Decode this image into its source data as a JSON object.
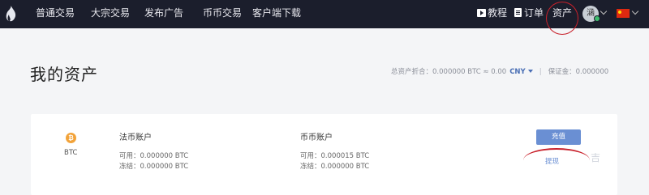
{
  "nav": {
    "items": [
      "普通交易",
      "大宗交易",
      "发布广告",
      "币币交易",
      "客户端下载"
    ],
    "tutorial": "教程",
    "orders": "订单",
    "assets": "资产",
    "avatar_initial": "涵"
  },
  "page": {
    "title": "我的资产",
    "total_label": "总资产折合：",
    "total_value": "0.000000 BTC ≈ 0.00",
    "currency": "CNY",
    "deposit_label": "保证金：",
    "deposit_value": "0.000000"
  },
  "asset": {
    "coin": "BTC",
    "coin_icon": "₿",
    "fiat_account": {
      "title": "法币账户",
      "available_label": "可用：",
      "available": "0.000000 BTC",
      "frozen_label": "冻结：",
      "frozen": "0.000000 BTC"
    },
    "coin_account": {
      "title": "币币账户",
      "available_label": "可用：",
      "available": "0.000015 BTC",
      "frozen_label": "冻结：",
      "frozen": "0.000000 BTC"
    },
    "recharge_label": "充值",
    "withdraw_label": "提现"
  },
  "watermark": "吉"
}
